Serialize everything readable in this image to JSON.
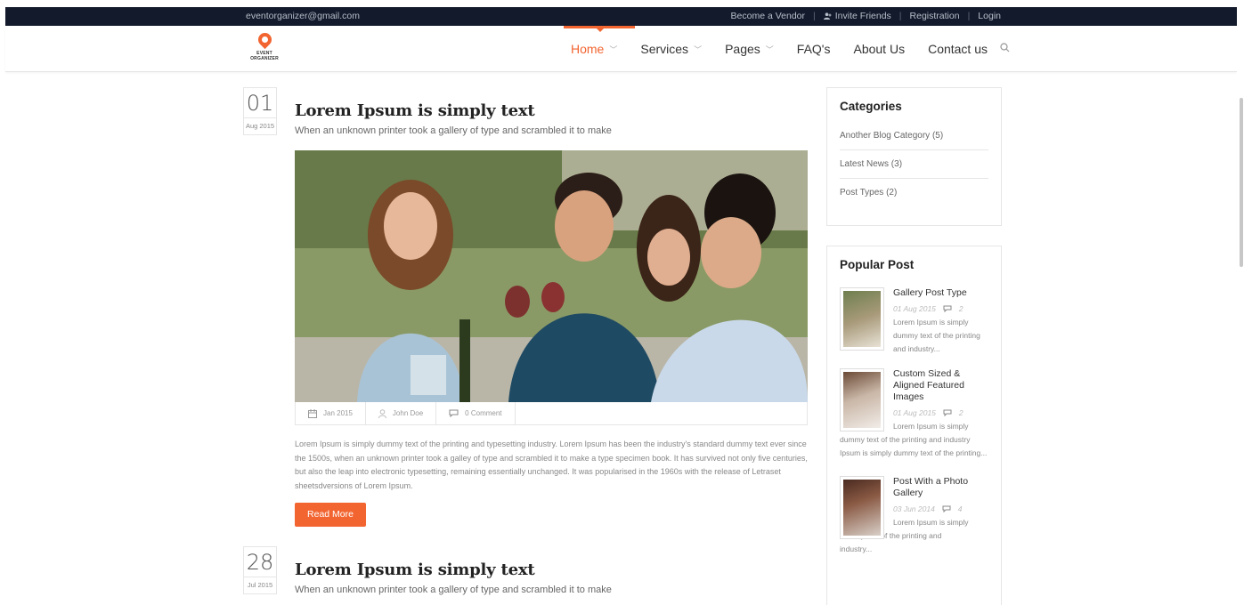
{
  "topbar": {
    "email": "eventorganizer@gmail.com",
    "links": [
      "Become a Vendor",
      "Invite Friends",
      "Registration",
      "Login"
    ]
  },
  "logo": {
    "text": "EVENT ORGANIZER"
  },
  "nav": {
    "items": [
      "Home",
      "Services",
      "Pages",
      "FAQ's",
      "About Us",
      "Contact us"
    ],
    "active": "Home"
  },
  "posts": [
    {
      "day": "01",
      "month": "Aug 2015",
      "title": "Lorem Ipsum is simply text",
      "subtitle": "When an unknown printer took a gallery of type and scrambled it to make",
      "meta": {
        "date": "Jan 2015",
        "author": "John Doe",
        "comments": "0 Comment"
      },
      "body": "Lorem Ipsum is simply dummy text of the printing and typesetting industry. Lorem Ipsum has been the industry's standard dummy text ever since the 1500s, when an unknown printer took a galley of type and scrambled it to make a type specimen book. It has survived not only five centuries, but also the leap into electronic typesetting, remaining essentially unchanged. It was popularised in the 1960s with the release of Letraset sheetsdversions of Lorem Ipsum.",
      "read_more": "Read More"
    },
    {
      "day": "28",
      "month": "Jul 2015",
      "title": "Lorem Ipsum is simply text",
      "subtitle": "When an unknown printer took a gallery of type and scrambled it to make"
    }
  ],
  "sidebar": {
    "categories": {
      "title": "Categories",
      "items": [
        "Another Blog Category (5)",
        "Latest News (3)",
        "Post Types (2)"
      ]
    },
    "popular": {
      "title": "Popular Post",
      "items": [
        {
          "title": "Gallery Post Type",
          "date": "01 Aug 2015",
          "comments": "2",
          "desc": "Lorem Ipsum is simply dummy text of the printing and industry..."
        },
        {
          "title": "Custom Sized & Aligned Featured Images",
          "date": "01 Aug 2015",
          "comments": "2",
          "desc": "Lorem Ipsum is simply dummy text of the printing and industry Ipsum is simply dummy text of the printing..."
        },
        {
          "title": "Post With a Photo Gallery",
          "date": "03 Jun 2014",
          "comments": "4",
          "desc": "Lorem Ipsum is simply dummy text of the printing and industry..."
        }
      ]
    }
  },
  "colors": {
    "accent": "#f26430",
    "topbar": "#121a2b"
  }
}
